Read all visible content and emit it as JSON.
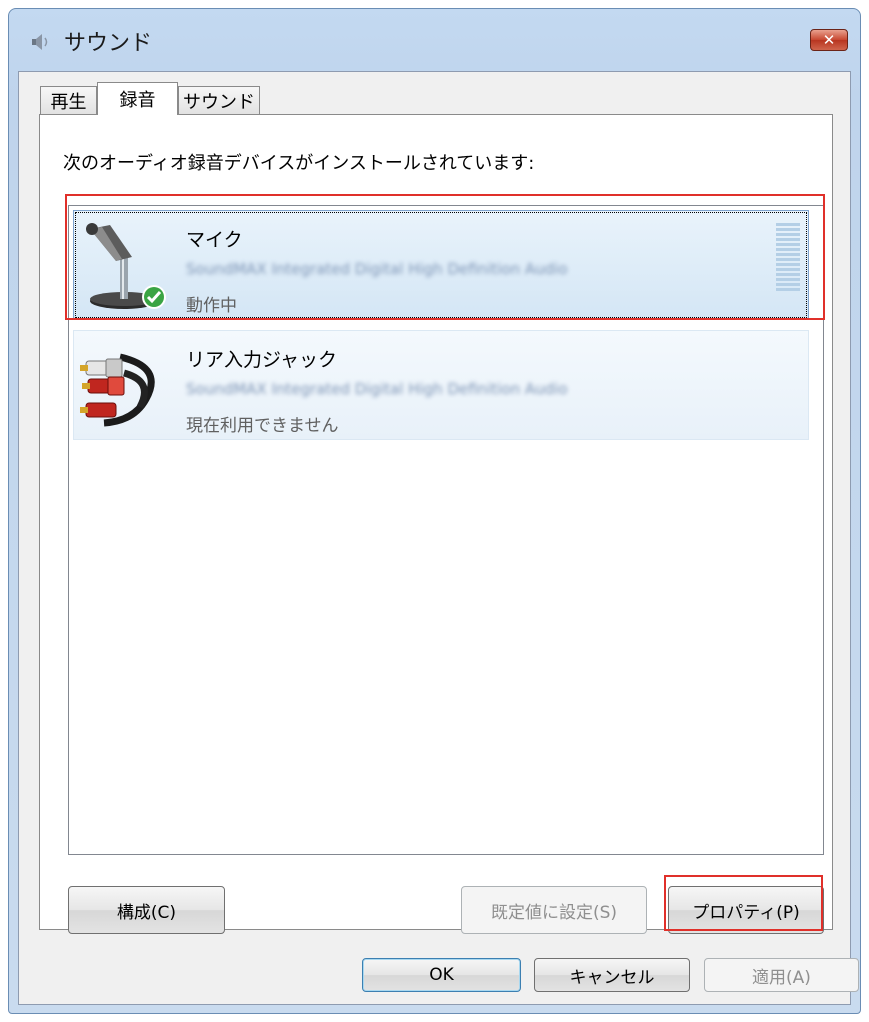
{
  "window": {
    "title": "サウンド",
    "close_label": "✕"
  },
  "tabs": [
    {
      "label": "再生",
      "active": false
    },
    {
      "label": "録音",
      "active": true
    },
    {
      "label": "サウンド",
      "active": false
    }
  ],
  "instruction": "次のオーディオ録音デバイスがインストールされています:",
  "devices": [
    {
      "name": "マイク",
      "description": "SoundMAX Integrated Digital High Definition Audio",
      "status": "動作中",
      "selected": true,
      "default": true
    },
    {
      "name": "リア入力ジャック",
      "description": "SoundMAX Integrated Digital High Definition Audio",
      "status": "現在利用できません",
      "selected": false,
      "default": false
    }
  ],
  "panel_buttons": {
    "configure": "構成(C)",
    "set_default": "既定値に設定(S)",
    "properties": "プロパティ(P)"
  },
  "dialog_buttons": {
    "ok": "OK",
    "cancel": "キャンセル",
    "apply": "適用(A)"
  },
  "colors": {
    "highlight": "#e0302a",
    "selection": "#d4e6f5"
  }
}
